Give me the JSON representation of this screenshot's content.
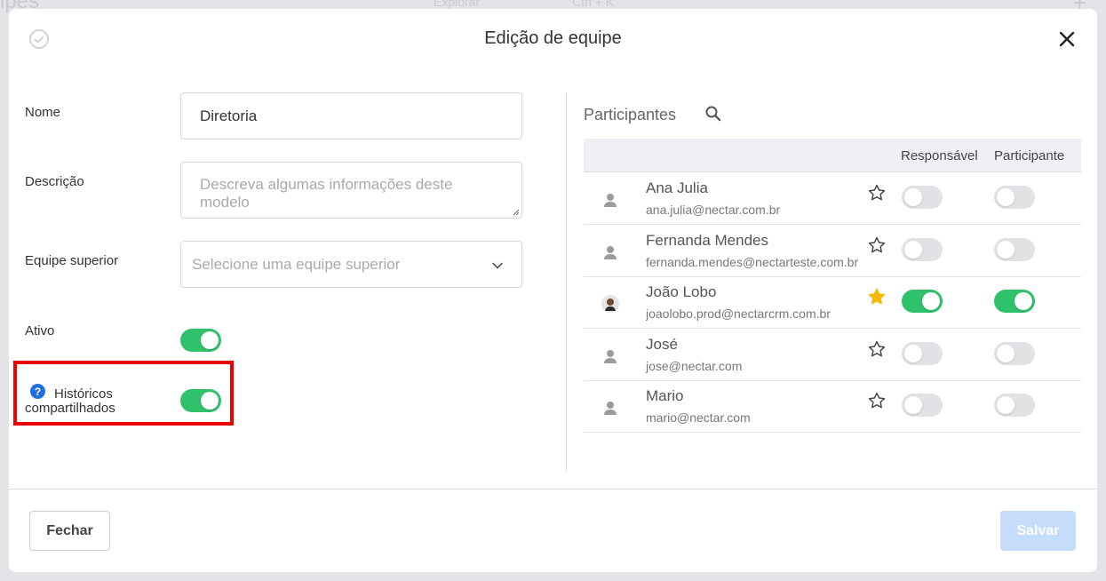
{
  "background": {
    "title": "ipes",
    "search_label": "Explorar",
    "search_shortcut": "Ctrl + K",
    "plus": "+"
  },
  "modal": {
    "title": "Edição de equipe",
    "close_icon": "close-icon",
    "check_icon": "check-circle-icon"
  },
  "form": {
    "name_label": "Nome",
    "name_value": "Diretoria",
    "description_label": "Descrição",
    "description_placeholder": "Descreva algumas informações deste modelo",
    "parent_team_label": "Equipe superior",
    "parent_team_placeholder": "Selecione uma equipe superior",
    "active_label": "Ativo",
    "active_value": true,
    "shared_history_label_line1": "Históricos",
    "shared_history_label_line2": "compartilhados",
    "shared_history_value": true,
    "help_icon": "question-circle-icon"
  },
  "participants": {
    "title": "Participantes",
    "search_icon": "search-icon",
    "columns": {
      "responsible": "Responsável",
      "participant": "Participante"
    },
    "rows": [
      {
        "name": "Ana Julia",
        "email": "ana.julia@nectar.com.br",
        "starred": false,
        "responsible": false,
        "participant": false
      },
      {
        "name": "Fernanda Mendes",
        "email": "fernanda.mendes@nectarteste.com.br",
        "starred": false,
        "responsible": false,
        "participant": false
      },
      {
        "name": "João Lobo",
        "email": "joaolobo.prod@nectarcrm.com.br",
        "starred": true,
        "responsible": true,
        "participant": true
      },
      {
        "name": "José",
        "email": "jose@nectar.com",
        "starred": false,
        "responsible": false,
        "participant": false
      },
      {
        "name": "Mario",
        "email": "mario@nectar.com",
        "starred": false,
        "responsible": false,
        "participant": false
      }
    ]
  },
  "footer": {
    "close_label": "Fechar",
    "save_label": "Salvar"
  },
  "colors": {
    "toggle_on": "#2fc26a",
    "toggle_off": "#e2e2e6",
    "highlight": "#ec0000",
    "star_active": "#f5b800",
    "save_disabled": "#c5dcfb",
    "help_icon": "#1f6fe5"
  }
}
